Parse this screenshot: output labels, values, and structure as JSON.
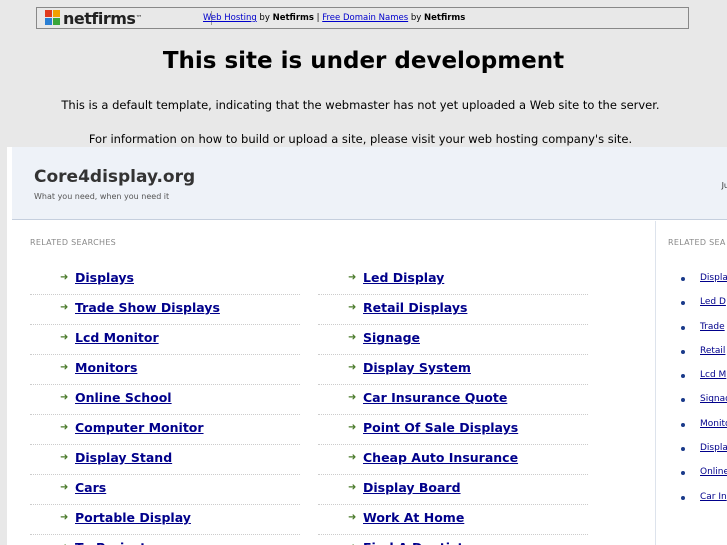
{
  "banner": {
    "logo_text": "netfirms",
    "logo_mark": "™",
    "link1": "Web Hosting",
    "by1": " by ",
    "brand1": "Netfirms",
    "sep": " | ",
    "link2": "Free Domain Names",
    "by2": " by ",
    "brand2": "Netfirms",
    "logo_colors": [
      "#e03a1e",
      "#f2a000",
      "#2a7fd4",
      "#3aa63a"
    ]
  },
  "notice": {
    "title": "This site is under development",
    "line1": "This is a default template, indicating that the webmaster has not yet uploaded a Web site to the server.",
    "line2": "For information on how to build or upload a site, please visit your web hosting company's site."
  },
  "site": {
    "title": "Core4display.org",
    "tagline": "What you need, when you need it",
    "date_fragment": "Ju",
    "left_label": "RELATED SEARCHES",
    "right_label": "RELATED SEA",
    "col1": [
      "Displays",
      "Trade Show Displays",
      "Lcd Monitor",
      "Monitors",
      "Online School",
      "Computer Monitor",
      "Display Stand",
      "Cars",
      "Portable Display",
      "Tv Projector"
    ],
    "col2": [
      "Led Display",
      "Retail Displays",
      "Signage",
      "Display System",
      "Car Insurance Quote",
      "Point Of Sale Displays",
      "Cheap Auto Insurance",
      "Display Board",
      "Work At Home",
      "Find A Dentist"
    ],
    "right": [
      "Displa",
      "Led D",
      "Trade",
      "Retail",
      "Lcd M",
      "Signag",
      "Monito",
      "Displa",
      "Online",
      "Car In"
    ]
  }
}
